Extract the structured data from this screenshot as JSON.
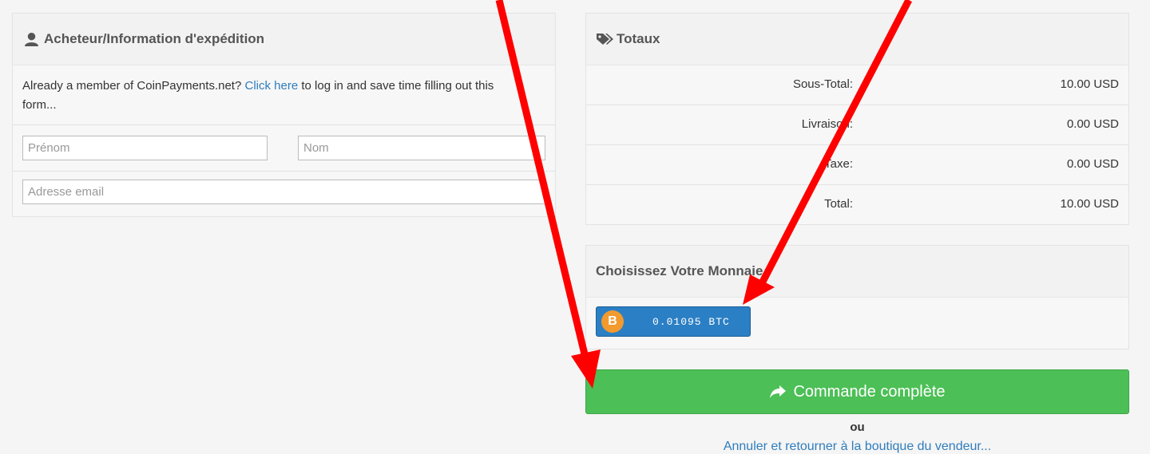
{
  "buyer": {
    "title": "Acheteur/Information d'expédition",
    "member_text": "Already a member of CoinPayments.net?",
    "click_here": "Click here",
    "member_text_2": "to log in and save time filling out this form...",
    "first_name_placeholder": "Prénom",
    "last_name_placeholder": "Nom",
    "email_placeholder": "Adresse email"
  },
  "totals": {
    "title": "Totaux",
    "rows": [
      {
        "label": "Sous-Total:",
        "value": "10.00 USD"
      },
      {
        "label": "Livraison:",
        "value": "0.00 USD"
      },
      {
        "label": "Taxe:",
        "value": "0.00 USD"
      },
      {
        "label": "Total:",
        "value": "10.00 USD"
      }
    ]
  },
  "currency": {
    "title": "Choisissez Votre Monnaie",
    "coin_symbol": "B",
    "coin_amount": "0.01095 BTC"
  },
  "complete_button": "Commande complète",
  "or_text": "ou",
  "cancel_link": "Annuler et retourner à la boutique du vendeur...",
  "colors": {
    "complete_green": "#4cbf56",
    "btc_blue": "#2b7fc4",
    "btc_orange": "#f29a2e",
    "arrow_red": "#ff0000",
    "link_blue": "#2f7dbd"
  },
  "icons": [
    "user-icon",
    "tags-icon",
    "bitcoin-icon",
    "share-arrow-icon"
  ]
}
